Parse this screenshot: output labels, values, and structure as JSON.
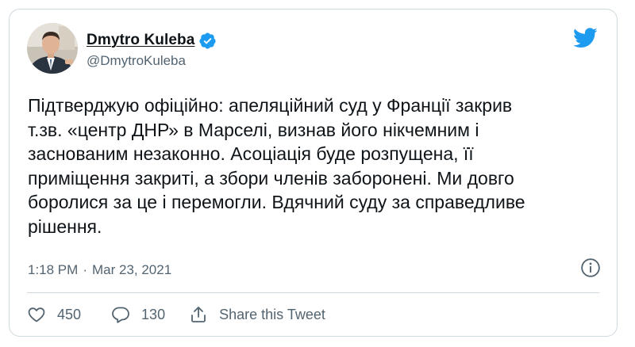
{
  "author": {
    "name": "Dmytro Kuleba",
    "handle": "@DmytroKuleba",
    "verified": true
  },
  "tweet": {
    "text": "Підтверджую офіційно: апеляційний суд у Франції закрив\nт.зв. «центр ДНР» в Марселі, визнав його нікчемним і\nзаснованим незаконно. Асоціація буде розпущена, її\nприміщення закриті, а збори членів заборонені. Ми довго\nборолися за це і перемогли. Вдячний суду за справедливе\nрішення.",
    "time": "1:18 PM",
    "separator": "·",
    "date": "Mar 23, 2021"
  },
  "actions": {
    "likes": "450",
    "replies": "130",
    "share_label": "Share this Tweet"
  },
  "icons": {
    "like": "heart-icon",
    "reply": "speech-bubble-icon",
    "share": "share-upload-icon",
    "info": "info-icon",
    "brand": "twitter-bird-logo",
    "verified": "verified-badge-icon"
  },
  "colors": {
    "brand_blue": "#1d9bf0",
    "text_primary": "#0f1419",
    "text_secondary": "#536471",
    "border": "#cfd9de"
  }
}
